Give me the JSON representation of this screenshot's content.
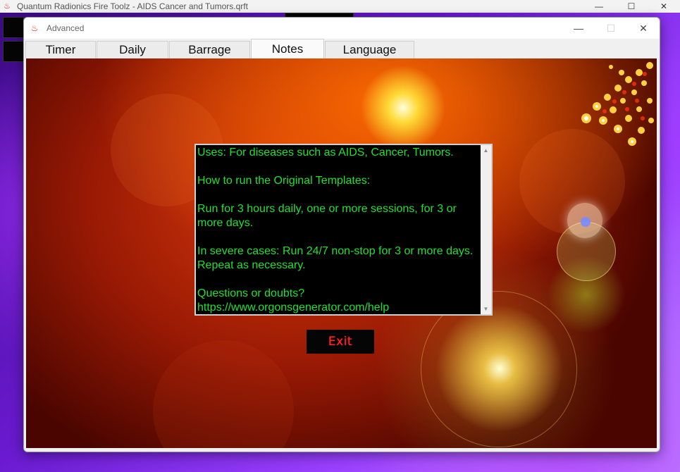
{
  "parent": {
    "title": "Quantum Radionics Fire Toolz - AIDS Cancer and Tumors.qrft",
    "minimize": "—",
    "maximize": "☐",
    "close": "✕"
  },
  "dialog": {
    "title": "Advanced",
    "minimize": "—",
    "maximize": "☐",
    "close": "✕"
  },
  "tabs": [
    {
      "label": "Timer",
      "active": false
    },
    {
      "label": "Daily",
      "active": false
    },
    {
      "label": "Barrage",
      "active": false
    },
    {
      "label": "Notes",
      "active": true
    },
    {
      "label": "Language",
      "active": false
    }
  ],
  "notes": {
    "text": "Uses: For diseases such as AIDS, Cancer, Tumors.\n\nHow to run the Original Templates:\n\nRun for 3 hours daily, one or more sessions, for 3 or more days.\n\nIn severe cases: Run 24/7 non-stop for 3 or more days.\nRepeat as necessary.\n\nQuestions or doubts?\nhttps://www.orgonsgenerator.com/help"
  },
  "exit_button": {
    "label": "Exit"
  },
  "colors": {
    "notes_text": "#20e030",
    "exit_text": "#ff2828"
  }
}
